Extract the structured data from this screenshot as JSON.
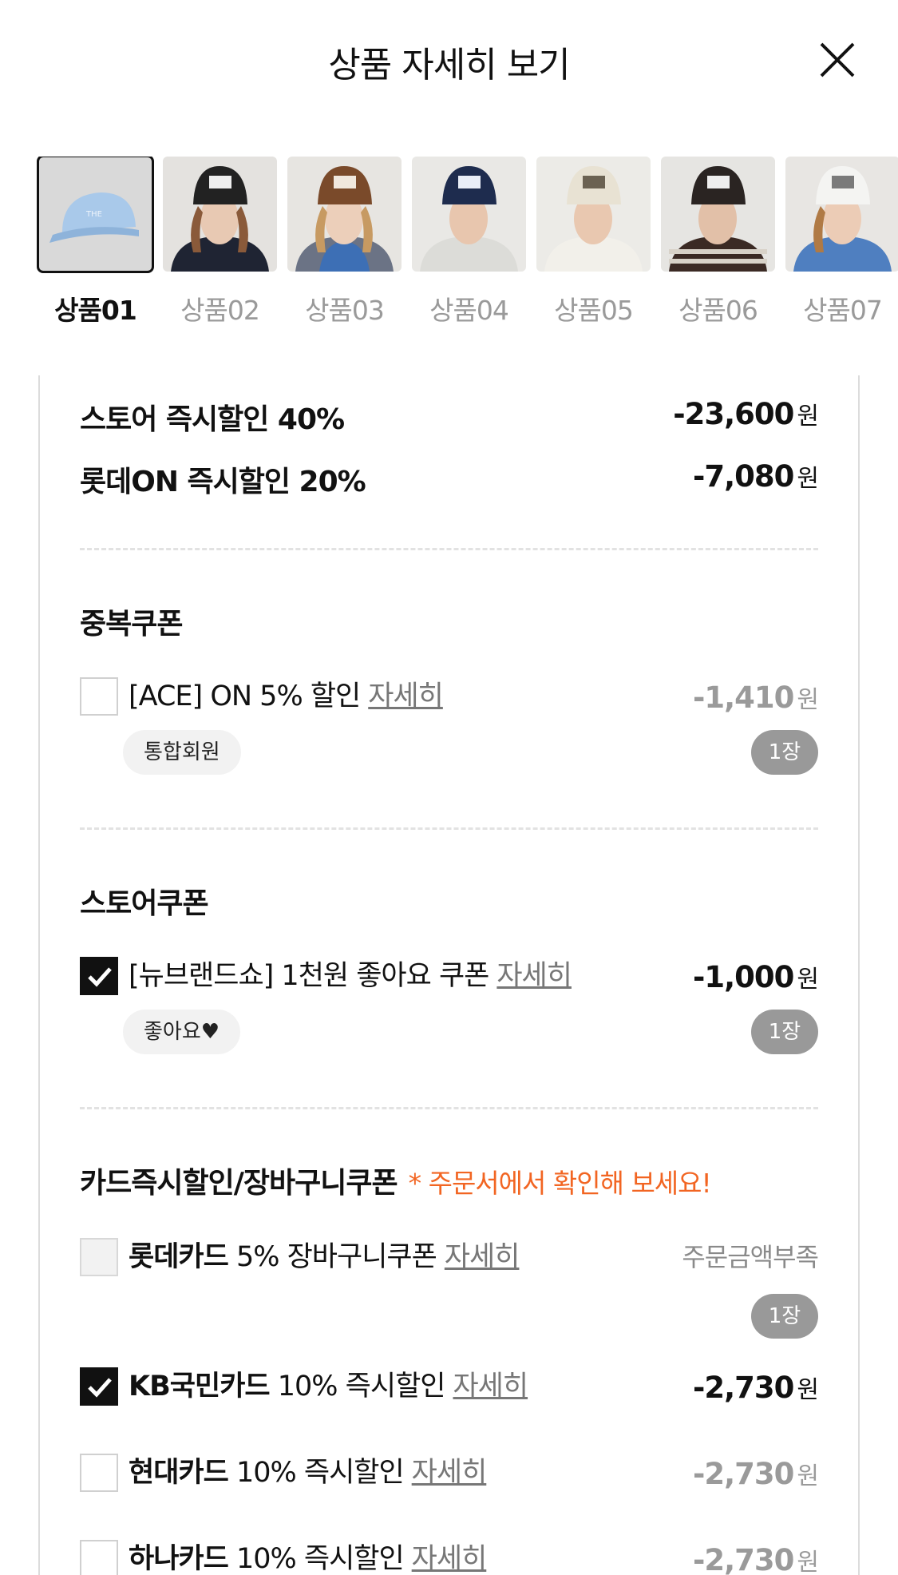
{
  "header": {
    "title": "상품 자세히 보기"
  },
  "thumbnails": [
    {
      "label": "상품01",
      "selected": true
    },
    {
      "label": "상품02"
    },
    {
      "label": "상품03"
    },
    {
      "label": "상품04"
    },
    {
      "label": "상품05"
    },
    {
      "label": "상품06"
    },
    {
      "label": "상품07"
    }
  ],
  "instant_discounts": [
    {
      "label": "스토어 즉시할인 40%",
      "amount": "-23,600",
      "unit": "원"
    },
    {
      "label": "롯데ON 즉시할인 20%",
      "amount": "-7,080",
      "unit": "원"
    }
  ],
  "duplicate_coupon": {
    "title": "중복쿠폰",
    "item": {
      "name": "[ACE] ON 5% 할인",
      "detail": "자세히",
      "amount": "-1,410",
      "unit": "원",
      "tag": "통합회원",
      "count": "1장",
      "checked": false
    }
  },
  "store_coupon": {
    "title": "스토어쿠폰",
    "item": {
      "name": "[뉴브랜드쇼] 1천원 좋아요 쿠폰",
      "detail": "자세히",
      "amount": "-1,000",
      "unit": "원",
      "tag": "좋아요♥",
      "count": "1장",
      "checked": true
    }
  },
  "card_section": {
    "title": "카드즉시할인/장바구니쿠폰",
    "notice": "* 주문서에서 확인해 보세요!",
    "items": [
      {
        "card": "롯데카드",
        "name": "5% 장바구니쿠폰",
        "detail": "자세히",
        "status": "주문금액부족",
        "count": "1장",
        "checked": false,
        "disabled": true
      },
      {
        "card": "KB국민카드",
        "name": "10% 즉시할인",
        "detail": "자세히",
        "amount": "-2,730",
        "unit": "원",
        "checked": true
      },
      {
        "card": "현대카드",
        "name": "10% 즉시할인",
        "detail": "자세히",
        "amount": "-2,730",
        "unit": "원",
        "checked": false
      },
      {
        "card": "하나카드",
        "name": "10% 즉시할인",
        "detail": "자세히",
        "amount": "-2,730",
        "unit": "원",
        "checked": false
      }
    ]
  },
  "colors": {
    "accent": "#f26522",
    "checked": "#111111",
    "pill": "#999999"
  }
}
